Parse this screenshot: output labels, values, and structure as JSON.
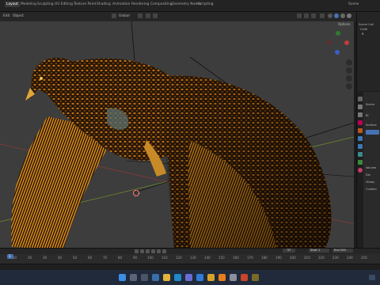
{
  "topbar": {
    "tabs": [
      "Layout",
      "Modeling",
      "Sculpting",
      "UV Editing",
      "Texture Paint",
      "Shading",
      "Animation",
      "Rendering",
      "Compositing",
      "Geometry Nodes",
      "Scripting"
    ],
    "active_tab": "Layout",
    "scene_label": "Scene"
  },
  "viewport_header": {
    "edit_menu": "Edit",
    "object_menu": "Object",
    "transform_orientation": "Global",
    "options_label": "Options"
  },
  "outliner": {
    "items": [
      "Scene Coll",
      "Colle",
      "B"
    ]
  },
  "properties": {
    "rows": [
      "Scene",
      "Bi",
      "Surface",
      "Volume",
      "Dis",
      "Viewp",
      "Custom"
    ]
  },
  "timeline": {
    "current_frame": "1",
    "ticks": [
      "10",
      "20",
      "30",
      "40",
      "50",
      "60",
      "70",
      "80",
      "90",
      "100",
      "110",
      "120",
      "130",
      "140",
      "150",
      "160",
      "170",
      "180",
      "190",
      "200",
      "210",
      "220",
      "230",
      "240",
      "250"
    ],
    "current_frame_field": "97",
    "start_label": "Start",
    "start_value": "1",
    "end_label": "End",
    "end_value": "250"
  },
  "colors": {
    "accent": "#4772b3",
    "viewport_bg": "#3d3d3d",
    "panel_bg": "#252525",
    "taskbar_bg": "#202a3a"
  },
  "taskbar": {
    "icons": [
      "windows-icon",
      "search-icon",
      "task-view-icon",
      "widgets-icon",
      "explorer-icon",
      "edge-icon",
      "store-icon",
      "mail-icon",
      "chrome-icon",
      "blender-icon",
      "settings-icon"
    ]
  }
}
